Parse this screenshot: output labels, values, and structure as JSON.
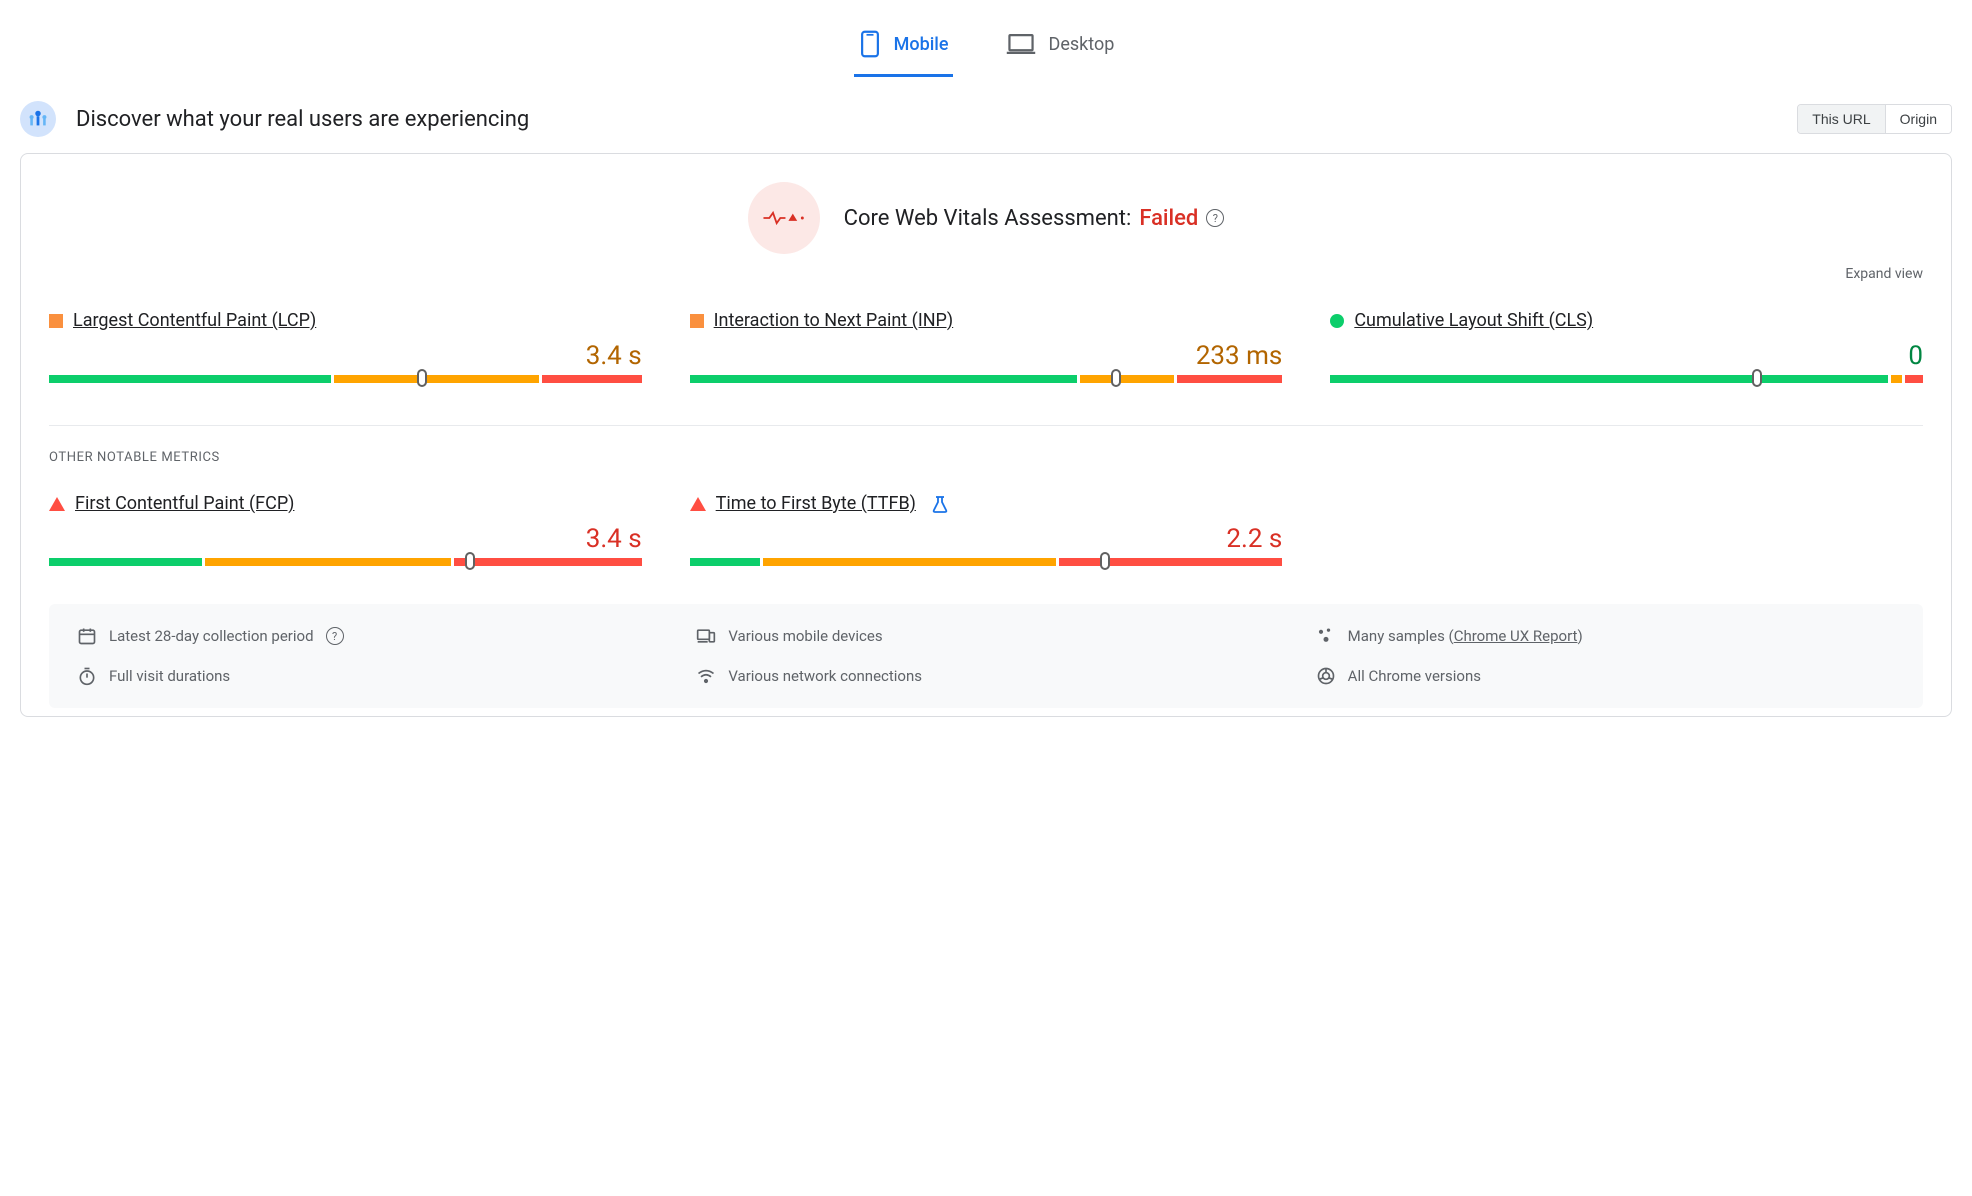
{
  "tabs": {
    "mobile": "Mobile",
    "desktop": "Desktop"
  },
  "header": {
    "title": "Discover what your real users are experiencing",
    "scope_this_url": "This URL",
    "scope_origin": "Origin"
  },
  "assessment": {
    "label": "Core Web Vitals Assessment: ",
    "status": "Failed"
  },
  "expand_view": "Expand view",
  "metrics": {
    "lcp": {
      "name": "Largest Contentful Paint (LCP)",
      "value": "3.4 s",
      "status": "orange",
      "segments": [
        48,
        35,
        17
      ],
      "marker": 63
    },
    "inp": {
      "name": "Interaction to Next Paint (INP)",
      "value": "233 ms",
      "status": "orange",
      "segments": [
        66,
        16,
        18
      ],
      "marker": 72
    },
    "cls": {
      "name": "Cumulative Layout Shift (CLS)",
      "value": "0",
      "status": "green",
      "segments": [
        95,
        2,
        3
      ],
      "marker": 72
    },
    "fcp": {
      "name": "First Contentful Paint (FCP)",
      "value": "3.4 s",
      "status": "red",
      "segments": [
        26,
        42,
        32
      ],
      "marker": 71
    },
    "ttfb": {
      "name": "Time to First Byte (TTFB)",
      "value": "2.2 s",
      "status": "red",
      "segments": [
        12,
        50,
        38
      ],
      "marker": 70
    }
  },
  "other_label": "OTHER NOTABLE METRICS",
  "footer": {
    "period": "Latest 28-day collection period",
    "devices": "Various mobile devices",
    "samples_prefix": "Many samples (",
    "samples_link": "Chrome UX Report",
    "samples_suffix": ")",
    "durations": "Full visit durations",
    "network": "Various network connections",
    "versions": "All Chrome versions"
  }
}
